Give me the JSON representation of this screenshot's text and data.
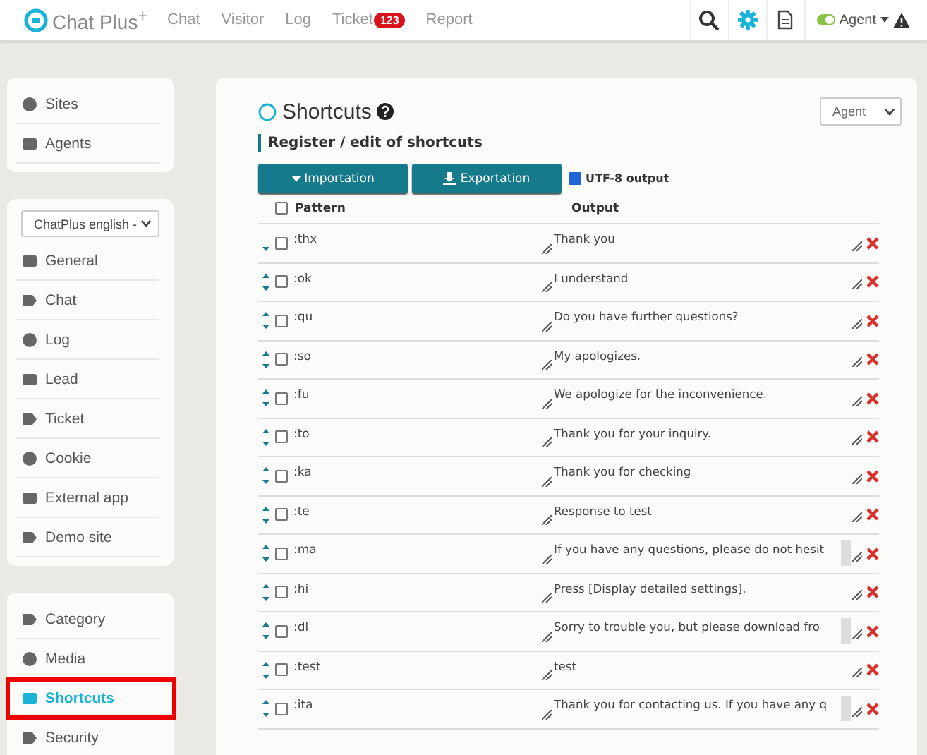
{
  "header": {
    "logo": "Chat Plus$^{+}$",
    "nav": [
      {
        "label": "Chat"
      },
      {
        "label": "Visitor"
      },
      {
        "label": "Log"
      },
      {
        "label": "Ticket",
        "badge": "123"
      },
      {
        "label": "Report"
      }
    ],
    "agent": {
      "label": "Agent",
      "on": true
    }
  },
  "sidebar": {
    "groups": [
      {
        "items": [
          {
            "label": "Sites",
            "selected": false,
            "annotated": false
          },
          {
            "label": "Agents",
            "selected": false,
            "annotated": false
          }
        ]
      },
      {
        "select": "ChatPlus english -",
        "items": [
          {
            "label": "General",
            "selected": false,
            "annotated": false
          },
          {
            "label": "Chat",
            "selected": false,
            "annotated": false
          },
          {
            "label": "Log",
            "selected": false,
            "annotated": false
          },
          {
            "label": "Lead",
            "selected": false,
            "annotated": false
          },
          {
            "label": "Ticket",
            "selected": false,
            "annotated": false
          },
          {
            "label": "Cookie",
            "selected": false,
            "annotated": false
          },
          {
            "label": "External app",
            "selected": false,
            "annotated": false
          },
          {
            "label": "Demo site",
            "selected": false,
            "annotated": false
          }
        ]
      },
      {
        "items": [
          {
            "label": "Category",
            "selected": false,
            "annotated": false
          },
          {
            "label": "Media",
            "selected": false,
            "annotated": false
          },
          {
            "label": "Shortcuts",
            "selected": true,
            "annotated": true
          },
          {
            "label": "Security",
            "selected": false,
            "annotated": false
          }
        ]
      }
    ]
  },
  "main": {
    "title": "Shortcuts",
    "scope_select": "Agent",
    "section": "Register / edit of shortcuts",
    "buttons": [
      "Importation",
      "Exportation"
    ],
    "utf8": {
      "label": "UTF-8 output",
      "checked": true
    },
    "select_all": {
      "checked": false
    },
    "columns": [
      "Pattern",
      "Output"
    ],
    "rows": [
      {
        "pattern": ":thx",
        "output": "Thank you",
        "overflow": false,
        "checked": false
      },
      {
        "pattern": ":ok",
        "output": "I understand",
        "overflow": false,
        "checked": false
      },
      {
        "pattern": ":qu",
        "output": "Do you have further questions?",
        "overflow": false,
        "checked": false
      },
      {
        "pattern": ":so",
        "output": "My apologizes.",
        "overflow": false,
        "checked": false
      },
      {
        "pattern": ":fu",
        "output": "We apologize for the inconvenience.",
        "overflow": false,
        "checked": false
      },
      {
        "pattern": ":to",
        "output": "Thank you for your inquiry.",
        "overflow": false,
        "checked": false
      },
      {
        "pattern": ":ka",
        "output": "Thank you for checking",
        "overflow": false,
        "checked": false
      },
      {
        "pattern": ":te",
        "output": "Response to test",
        "overflow": false,
        "checked": false
      },
      {
        "pattern": ":ma",
        "output": "If you have any questions, please do not hesit",
        "overflow": true,
        "checked": false
      },
      {
        "pattern": ":hi",
        "output": "Press [Display detailed settings].",
        "overflow": false,
        "checked": false
      },
      {
        "pattern": ":dl",
        "output": "Sorry to trouble you, but please download fro",
        "overflow": true,
        "checked": false
      },
      {
        "pattern": ":test",
        "output": "test",
        "overflow": false,
        "checked": false
      },
      {
        "pattern": ":ita",
        "output": "Thank you for contacting us. If you have any q",
        "overflow": true,
        "checked": false
      }
    ]
  }
}
